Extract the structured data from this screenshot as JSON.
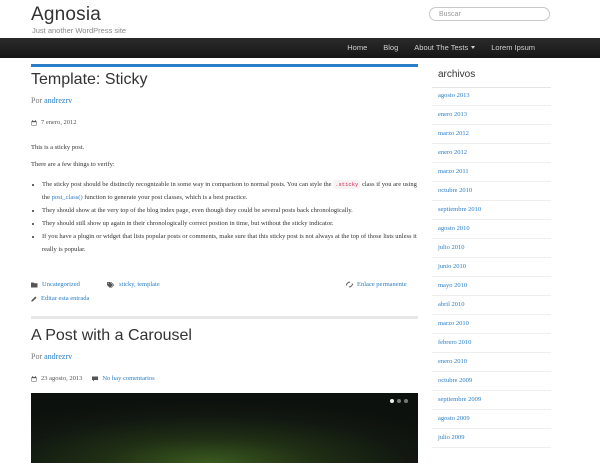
{
  "site": {
    "title": "Agnosia",
    "tagline": "Just another WordPress site"
  },
  "search": {
    "placeholder": "Buscar"
  },
  "nav": {
    "items": [
      {
        "label": "Home"
      },
      {
        "label": "Blog"
      },
      {
        "label": "About The Tests"
      },
      {
        "label": "Lorem Ipsum"
      }
    ]
  },
  "post1": {
    "title": "Template: Sticky",
    "by_prefix": "Por",
    "author": "andrezrv",
    "date": "7 enero, 2012",
    "intro": "This is a sticky post.",
    "intro2": "There are a few things to verify:",
    "bullet1_a": "The sticky post should be distinctly recognizable in some way in comparison to normal posts. You can style the",
    "bullet1_code": ".sticky",
    "bullet1_b": "class if",
    "bullet1_c": "you are using the",
    "bullet1_link": "post_class()",
    "bullet1_d": "function to generate your post classes, which is a best practice.",
    "bullet2": "They should show at the very top of the blog index page, even though they could be several posts back chronologically.",
    "bullet3": "They should still show up again in their chronologically correct postion in time, but without the sticky indicator.",
    "bullet4": "If you have a plugin or widget that lists popular posts or comments, make sure that this sticky post is not always at the top of those lists unless it really is popular.",
    "category": "Uncategorized",
    "tags": "sticky, template",
    "permalink": "Enlace permanente",
    "edit": "Editar esta entrada"
  },
  "post2": {
    "title": "A Post with a Carousel",
    "by_prefix": "Por",
    "author": "andrezrv",
    "date": "23 agosto, 2013",
    "comments": "No hay comentarios"
  },
  "sidebar": {
    "heading": "archivos",
    "archives": [
      "agosto 2013",
      "enero 2013",
      "marzo 2012",
      "enero 2012",
      "marzo 2011",
      "octubre 2010",
      "septiembre 2010",
      "agosto 2010",
      "julio 2010",
      "junio 2010",
      "mayo 2010",
      "abril 2010",
      "marzo 2010",
      "febrero 2010",
      "enero 2010",
      "octubre 2009",
      "septiembre 2009",
      "agosto 2009",
      "julio 2009"
    ]
  },
  "colors": {
    "link": "#2a7ec8",
    "accent": "#2a7ec8",
    "navbar": "#1c1c1c"
  },
  "icons": {
    "date": "calendar-icon",
    "comments": "comment-icon",
    "category": "folder-icon",
    "tags": "tags-icon",
    "permalink": "link-icon",
    "edit": "pencil-icon"
  },
  "carousel": {
    "slides": 3,
    "active": 1
  }
}
